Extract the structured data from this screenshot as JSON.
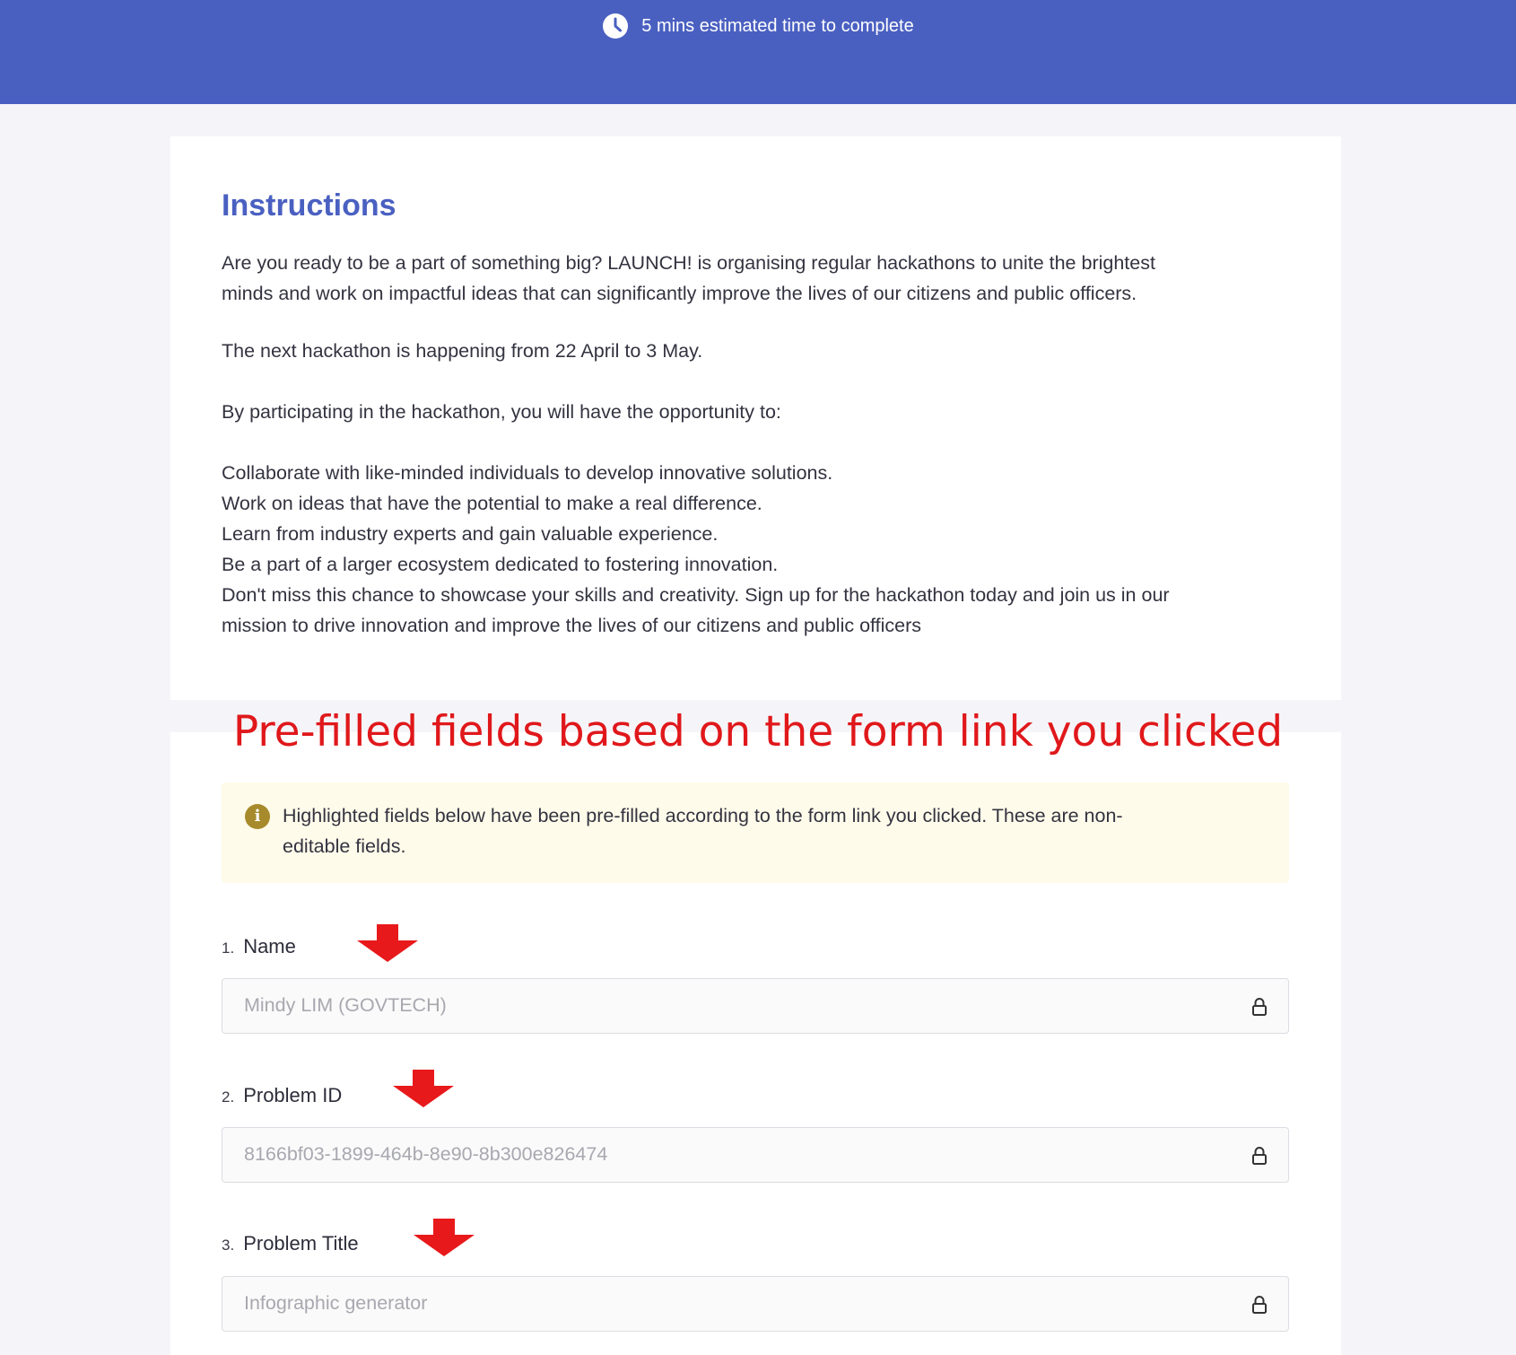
{
  "header": {
    "time_estimate": "5 mins estimated time to complete",
    "clock_icon": "clock-icon",
    "background_color": "#4a60c1"
  },
  "instructions": {
    "title": "Instructions",
    "paragraph_1_line_1": "Are you ready to be a part of something big? LAUNCH! is organising regular hackathons to unite the brightest",
    "paragraph_1_line_2": "minds and work on impactful ideas that can significantly improve the lives of our citizens and public officers.",
    "paragraph_2": "The next hackathon is happening from 22 April to 3 May.",
    "paragraph_3": "By participating in the hackathon, you will have the opportunity to:",
    "list": [
      "Collaborate with like-minded individuals to develop innovative solutions.",
      "Work on ideas that have the potential to make a real difference.",
      "Learn from industry experts and gain valuable experience.",
      "Be a part of a larger ecosystem dedicated to fostering innovation."
    ],
    "closing_line_1": "Don't miss this chance to showcase your skills and creativity. Sign up for the hackathon today and join us in our",
    "closing_line_2": "mission to drive innovation and improve the lives of our citizens and public officers"
  },
  "annotation": {
    "text": "Pre-filled fields based on the form link you clicked",
    "color": "#e0181b"
  },
  "info_box": {
    "icon": "info-icon",
    "line_1": "Highlighted fields below have been pre-filled according to the form link you clicked. These are non-",
    "line_2": "editable fields."
  },
  "fields": [
    {
      "number": "1.",
      "label": "Name",
      "value": "Mindy LIM (GOVTECH)",
      "icon": "lock-icon"
    },
    {
      "number": "2.",
      "label": "Problem ID",
      "value": "8166bf03-1899-464b-8e90-8b300e826474",
      "icon": "lock-icon"
    },
    {
      "number": "3.",
      "label": "Problem Title",
      "value": "Infographic generator",
      "icon": "lock-icon"
    }
  ]
}
